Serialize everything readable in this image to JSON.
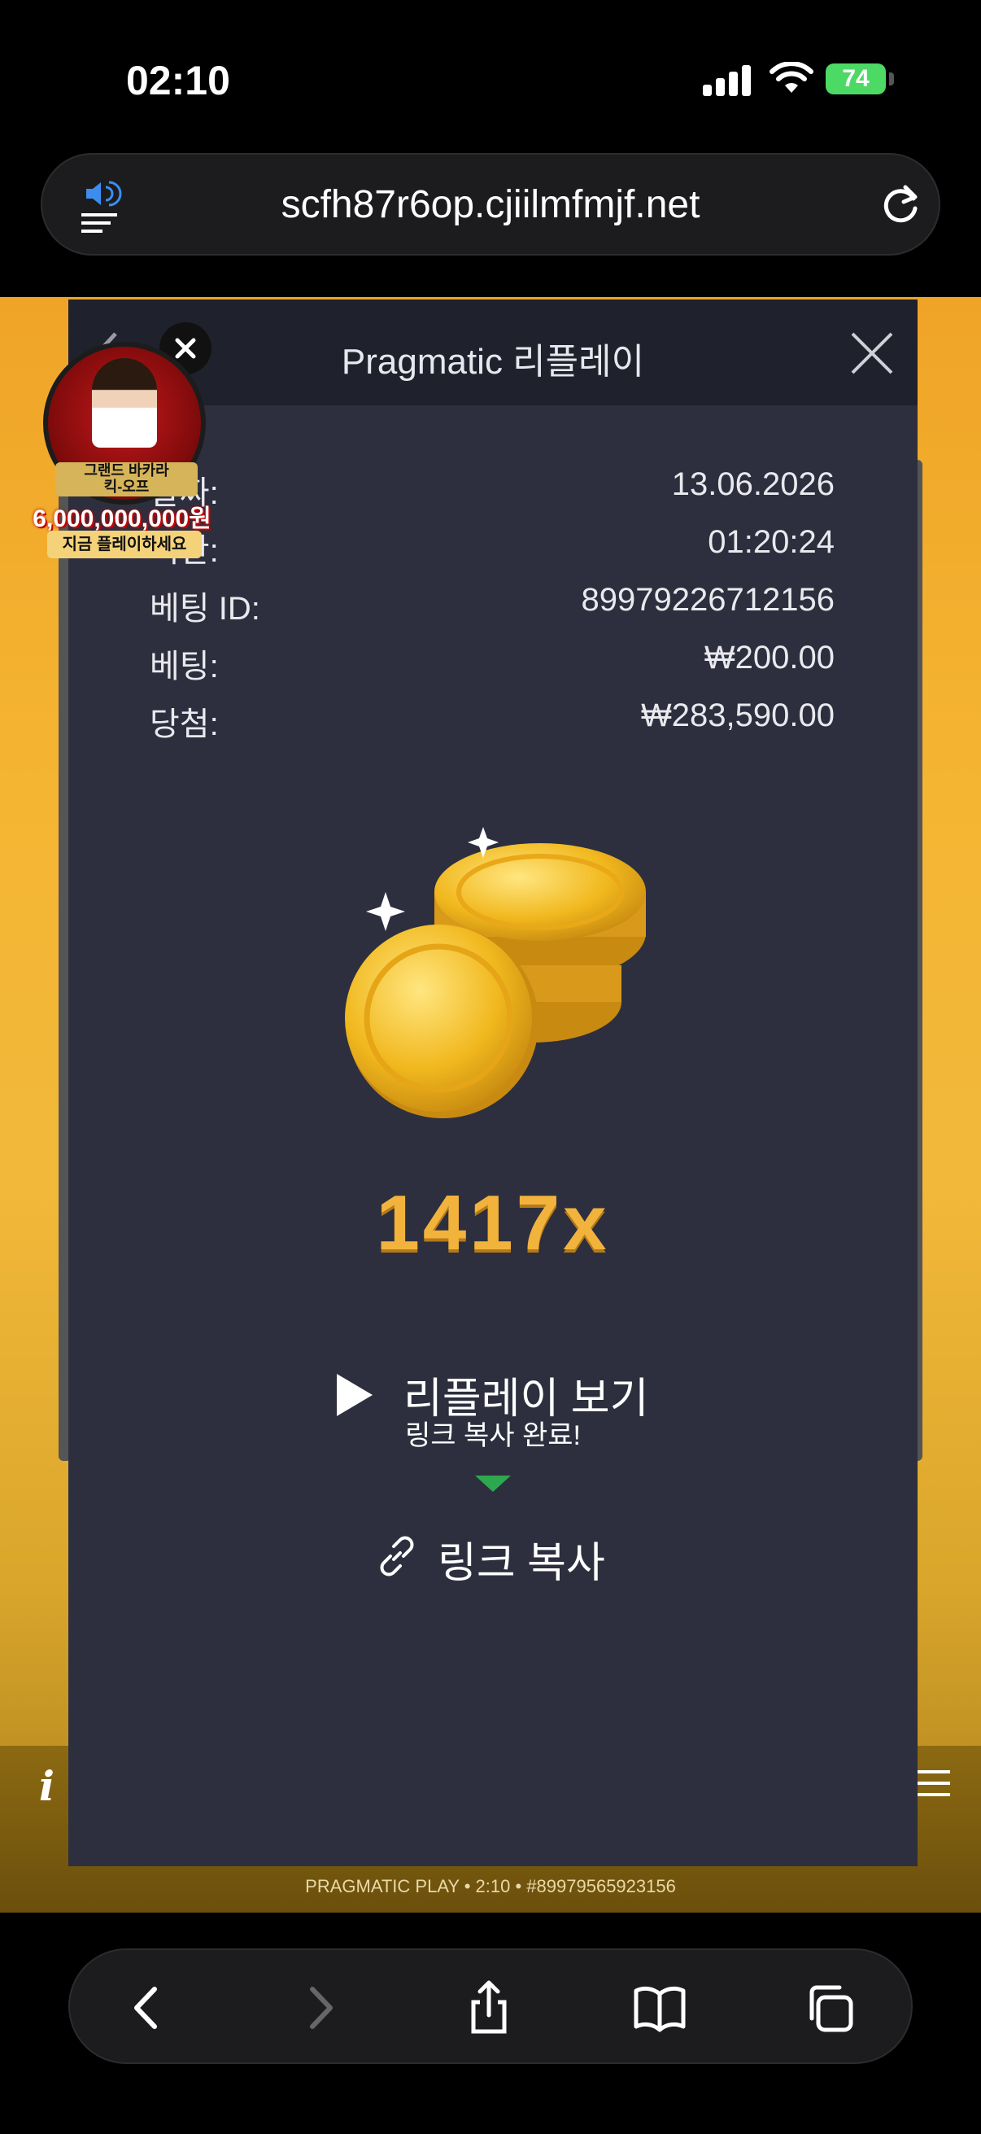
{
  "status_bar": {
    "time": "02:10",
    "battery": "74"
  },
  "browser": {
    "url": "scfh87r6op.cjiilmfmjf.net"
  },
  "promo": {
    "line1": "그랜드 바카라",
    "line2": "킥-오프",
    "amount": "6,000,000,000원",
    "cta": "지금 플레이하세요"
  },
  "modal": {
    "title": "Pragmatic 리플레이",
    "rows": [
      {
        "key": "날짜:",
        "value": "13.06.2026"
      },
      {
        "key": "시간:",
        "value": "01:20:24"
      },
      {
        "key": "베팅 ID:",
        "value": "89979226712156"
      },
      {
        "key": "베팅:",
        "value": "₩200.00"
      },
      {
        "key": "당첨:",
        "value": "₩283,590.00"
      }
    ],
    "multiplier": "1417x",
    "replay_label": "리플레이 보기",
    "tooltip": "링크 복사 완료!",
    "copy_label": "링크 복사"
  },
  "game": {
    "footer": "PRAGMATIC PLAY • 2:10 • #89979565923156"
  },
  "colors": {
    "modal_bg": "#2d2f3e",
    "accent_gold": "#f2b33c",
    "tooltip_green": "#2ea84e"
  }
}
